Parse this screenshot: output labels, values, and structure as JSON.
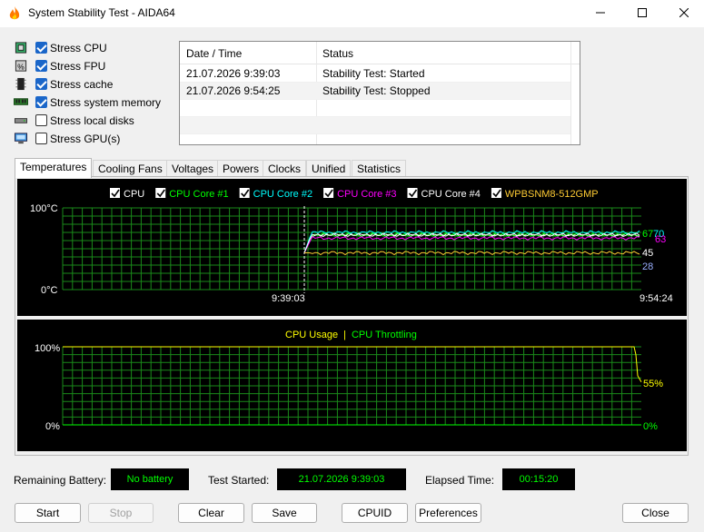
{
  "window": {
    "title": "System Stability Test - AIDA64"
  },
  "stress_options": [
    {
      "label": "Stress CPU",
      "checked": true,
      "icon": "cpu-chip-icon"
    },
    {
      "label": "Stress FPU",
      "checked": true,
      "icon": "fpu-chip-icon"
    },
    {
      "label": "Stress cache",
      "checked": true,
      "icon": "cache-icon"
    },
    {
      "label": "Stress system memory",
      "checked": true,
      "icon": "memory-module-icon"
    },
    {
      "label": "Stress local disks",
      "checked": false,
      "icon": "disk-drive-icon"
    },
    {
      "label": "Stress GPU(s)",
      "checked": false,
      "icon": "gpu-icon"
    }
  ],
  "log": {
    "columns": [
      "Date / Time",
      "Status"
    ],
    "rows": [
      [
        "21.07.2026 9:39:03",
        "Stability Test: Started"
      ],
      [
        "21.07.2026 9:54:25",
        "Stability Test: Stopped"
      ]
    ]
  },
  "tabs": [
    "Temperatures",
    "Cooling Fans",
    "Voltages",
    "Powers",
    "Clocks",
    "Unified",
    "Statistics"
  ],
  "active_tab": "Temperatures",
  "temperature_chart": {
    "legend": [
      {
        "label": "CPU",
        "color": "#ffffff",
        "checked": true
      },
      {
        "label": "CPU Core #1",
        "color": "#00ff00",
        "checked": true
      },
      {
        "label": "CPU Core #2",
        "color": "#00ffff",
        "checked": true
      },
      {
        "label": "CPU Core #3",
        "color": "#ff00ff",
        "checked": true
      },
      {
        "label": "CPU Core #4",
        "color": "#ffffff",
        "checked": true
      },
      {
        "label": "WPBSNM8-512GMP",
        "color": "#ffcc33",
        "checked": true
      }
    ],
    "y_top_label": "100°C",
    "y_bottom_label": "0°C",
    "x_start_label": "9:39:03",
    "x_end_label": "9:54:24",
    "value_labels": [
      {
        "text": "67",
        "color": "#00ff00"
      },
      {
        "text": "70",
        "color": "#00ffff"
      },
      {
        "text": "63",
        "color": "#ff00ff"
      },
      {
        "text": "45",
        "color": "#ffffff"
      },
      {
        "text": "28",
        "color": "#9ab0ff"
      }
    ]
  },
  "usage_chart": {
    "legend": [
      {
        "label": "CPU Usage",
        "color": "#ffff00"
      },
      {
        "label": "|",
        "color": "#ffff00"
      },
      {
        "label": "CPU Throttling",
        "color": "#00ff00"
      }
    ],
    "y_top_label": "100%",
    "y_bottom_label": "0%",
    "right_top_label": "55%",
    "right_bottom_label": "0%"
  },
  "chart_data": [
    {
      "type": "line",
      "y_unit": "°C",
      "ylim": [
        0,
        100
      ],
      "x_range": [
        "9:39:03",
        "9:54:24"
      ],
      "series": [
        {
          "name": "CPU",
          "level": 67
        },
        {
          "name": "CPU Core #1",
          "level": 67
        },
        {
          "name": "CPU Core #2",
          "level": 70
        },
        {
          "name": "CPU Core #3",
          "level": 63
        },
        {
          "name": "CPU Core #4",
          "level": 67
        },
        {
          "name": "WPBSNM8-512GMP",
          "level": 45
        }
      ]
    },
    {
      "type": "line",
      "y_unit": "%",
      "ylim": [
        0,
        100
      ],
      "series": [
        {
          "name": "CPU Usage",
          "level": 100,
          "final": 55
        },
        {
          "name": "CPU Throttling",
          "level": 0
        }
      ]
    }
  ],
  "footer": {
    "remaining_battery_label": "Remaining Battery:",
    "remaining_battery_value": "No battery",
    "test_started_label": "Test Started:",
    "test_started_value": "21.07.2026 9:39:03",
    "elapsed_label": "Elapsed Time:",
    "elapsed_value": "00:15:20"
  },
  "buttons": {
    "start": "Start",
    "stop": "Stop",
    "clear": "Clear",
    "save": "Save",
    "cpuid": "CPUID",
    "preferences": "Preferences",
    "close": "Close"
  }
}
